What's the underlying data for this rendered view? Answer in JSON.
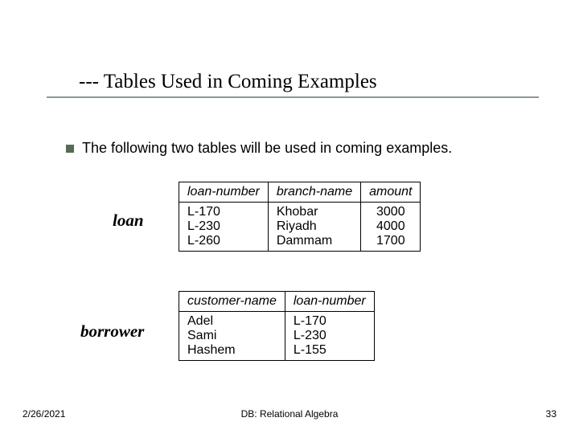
{
  "title": "--- Tables Used in Coming Examples",
  "bullet": "The following two tables will be used in coming examples.",
  "loan": {
    "label": "loan",
    "headers": {
      "c0": "loan-number",
      "c1": "branch-name",
      "c2": "amount"
    },
    "rows": [
      {
        "c0": "L-170",
        "c1": "Khobar",
        "c2": "3000"
      },
      {
        "c0": "L-230",
        "c1": "Riyadh",
        "c2": "4000"
      },
      {
        "c0": "L-260",
        "c1": "Dammam",
        "c2": "1700"
      }
    ]
  },
  "borrower": {
    "label": "borrower",
    "headers": {
      "c0": "customer-name",
      "c1": "loan-number"
    },
    "rows": [
      {
        "c0": "Adel",
        "c1": "L-170"
      },
      {
        "c0": "Sami",
        "c1": "L-230"
      },
      {
        "c0": "Hashem",
        "c1": "L-155"
      }
    ]
  },
  "footer": {
    "date": "2/26/2021",
    "mid": "DB: Relational Algebra",
    "page": "33"
  }
}
